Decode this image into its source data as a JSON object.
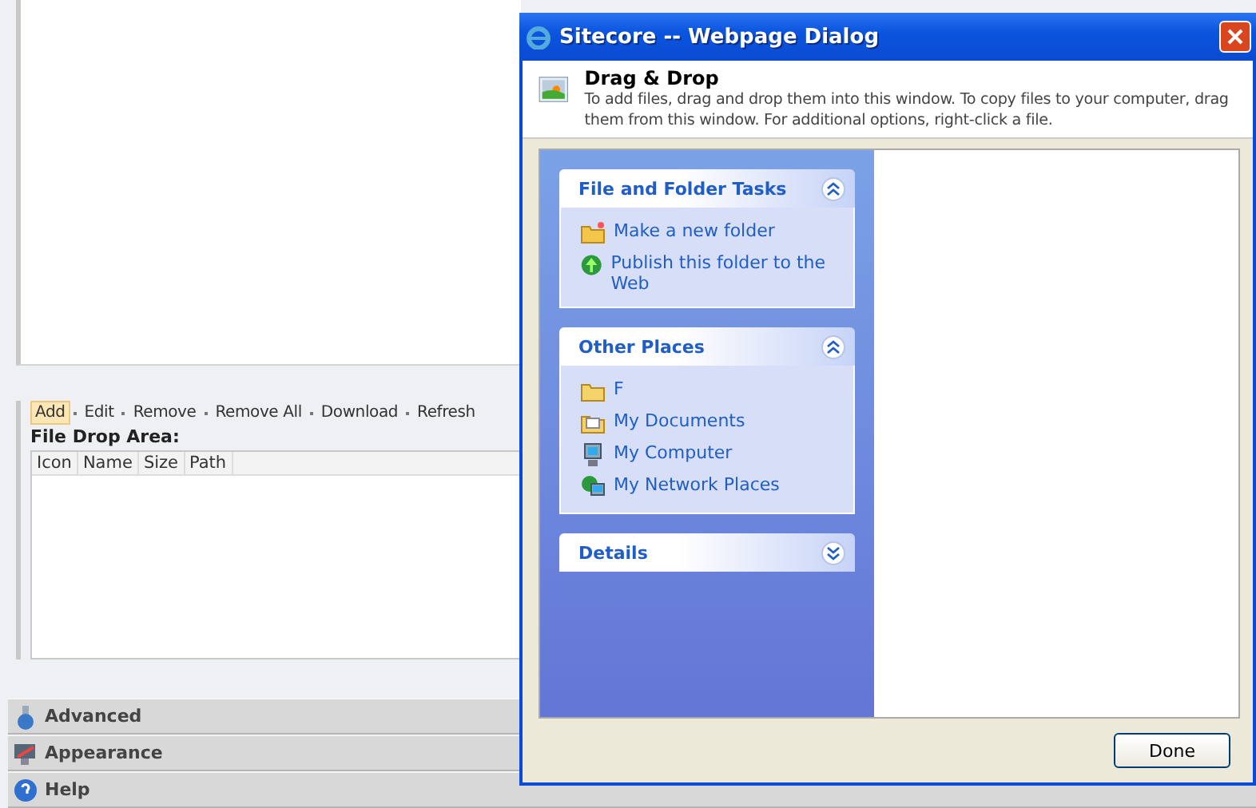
{
  "toolbar": [
    {
      "label": "Add",
      "selected": true
    },
    {
      "label": "Edit",
      "selected": false
    },
    {
      "label": "Remove",
      "selected": false
    },
    {
      "label": "Remove All",
      "selected": false
    },
    {
      "label": "Download",
      "selected": false
    },
    {
      "label": "Refresh",
      "selected": false
    }
  ],
  "file_drop_area": {
    "label": "File Drop Area:",
    "columns": [
      "Icon",
      "Name",
      "Size",
      "Path"
    ]
  },
  "sections": [
    {
      "label": "Advanced"
    },
    {
      "label": "Appearance"
    },
    {
      "label": "Help"
    }
  ],
  "dialog": {
    "title": "Sitecore -- Webpage Dialog",
    "heading": "Drag & Drop",
    "description": "To add files, drag and drop them into this window. To copy files to your computer, drag them from this window. For additional options, right-click a file.",
    "panels": [
      {
        "title": "File and Folder Tasks",
        "expanded": true,
        "items": [
          {
            "label": "Make a new folder"
          },
          {
            "label": "Publish this folder to the Web"
          }
        ]
      },
      {
        "title": "Other Places",
        "expanded": true,
        "items": [
          {
            "label": "F"
          },
          {
            "label": "My Documents"
          },
          {
            "label": "My Computer"
          },
          {
            "label": "My Network Places"
          }
        ]
      },
      {
        "title": "Details",
        "expanded": false
      }
    ],
    "button": "Done"
  }
}
